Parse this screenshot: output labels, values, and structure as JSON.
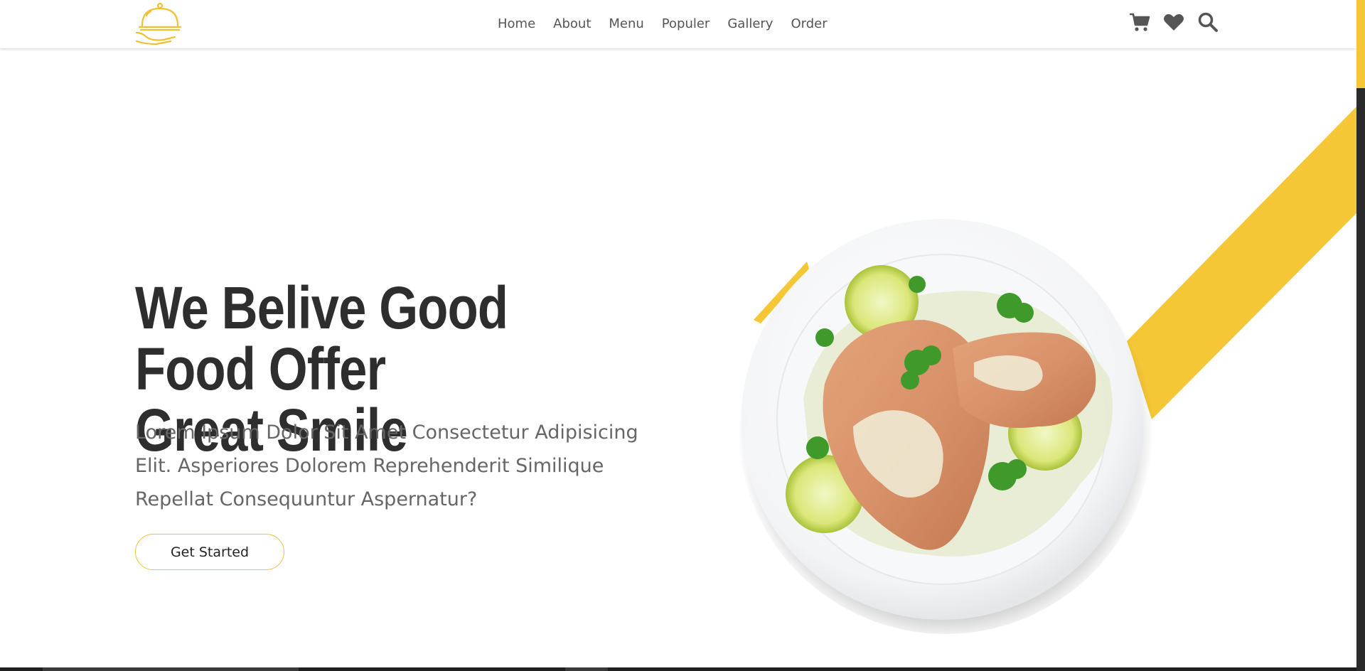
{
  "header": {
    "logo_icon": "serving-cloche-icon",
    "nav": [
      "Home",
      "About",
      "Menu",
      "Populer",
      "Gallery",
      "Order"
    ],
    "icons": [
      "shopping-cart-icon",
      "heart-icon",
      "search-icon"
    ]
  },
  "hero": {
    "title_line1": "We Belive Good Food Offer",
    "title_line2": "Great Smile",
    "description": "Lorem Ipsum Dolor Sit Amet Consectetur Adipisicing Elit. Asperiores Dolorem Reprehenderit Similique Repellat Consequuntur Aspernatur?",
    "cta_label": "Get Started",
    "image": "grilled-chicken-plate"
  },
  "colors": {
    "accent": "#f5c635",
    "text_dark": "#2e2e2e",
    "text_muted": "#666666"
  }
}
